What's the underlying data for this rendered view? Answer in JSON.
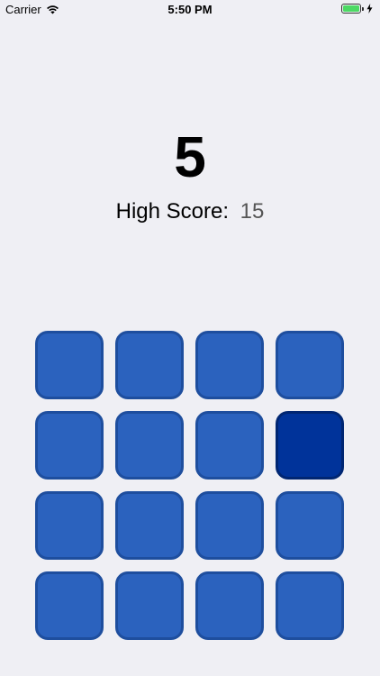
{
  "status_bar": {
    "carrier": "Carrier",
    "time": "5:50 PM",
    "battery_level": 1.0,
    "battery_color": "#4CD964",
    "wifi_icon": "wifi-icon",
    "charging_icon": "bolt-icon"
  },
  "game": {
    "score": "5",
    "high_score_label": "High Score:",
    "high_score_value": "15",
    "colors": {
      "background": "#EFEFF4",
      "tile": "#2B62BE",
      "tile_border": "#1E4E9E",
      "tile_active": "#00339A",
      "tile_active_border": "#002672"
    },
    "grid": {
      "rows": 4,
      "columns": 4,
      "active_tiles": [
        [
          1,
          3
        ]
      ]
    }
  }
}
